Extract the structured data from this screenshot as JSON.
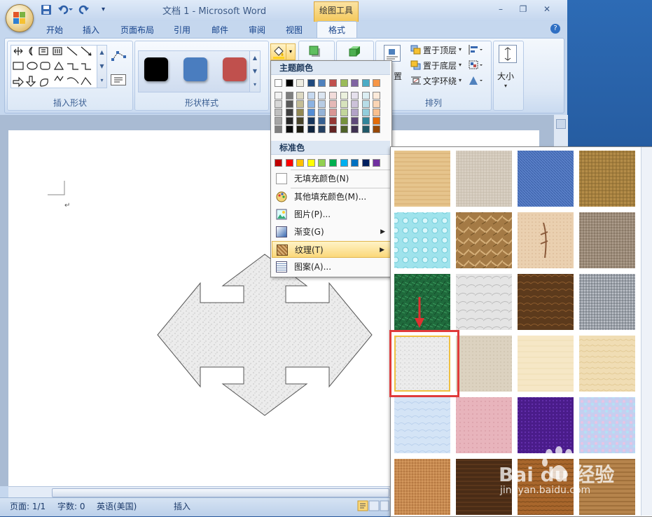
{
  "window": {
    "title": "文档 1 - Microsoft Word",
    "contextual_tab": "绘图工具",
    "min": "–",
    "max": "❐",
    "close": "✕"
  },
  "tabs": [
    "开始",
    "插入",
    "页面布局",
    "引用",
    "邮件",
    "审阅",
    "视图",
    "格式"
  ],
  "ribbon": {
    "groups": {
      "insert_shapes": "插入形状",
      "shape_styles": "形状样式",
      "arrange": "排列",
      "size": "大小"
    },
    "arrange": {
      "bring_front": "置于顶层",
      "send_back": "置于底层",
      "text_wrap": "文字环绕",
      "position_fragment": "置"
    },
    "style_colors": [
      "#000000",
      "#4a7dbf",
      "#c0504d"
    ]
  },
  "fill_menu": {
    "theme_colors_header": "主题颜色",
    "standard_colors_header": "标准色",
    "theme_top": [
      "#ffffff",
      "#000000",
      "#eeece1",
      "#1f497d",
      "#4f81bd",
      "#c0504d",
      "#9bbb59",
      "#8064a2",
      "#4bacc6",
      "#f79646"
    ],
    "theme_shades": [
      [
        "#f2f2f2",
        "#7f7f7f",
        "#ddd9c3",
        "#c6d9f0",
        "#dbe5f1",
        "#f2dcdb",
        "#ebf1dd",
        "#e5e0ec",
        "#dbeef3",
        "#fdeada"
      ],
      [
        "#d8d8d8",
        "#595959",
        "#c4bd97",
        "#8db3e2",
        "#b8cce4",
        "#e5b9b7",
        "#d7e3bc",
        "#ccc1d9",
        "#b7dde8",
        "#fbd5b5"
      ],
      [
        "#bfbfbf",
        "#3f3f3f",
        "#938953",
        "#548dd4",
        "#95b3d7",
        "#d99694",
        "#c3d69b",
        "#b2a2c7",
        "#92cddc",
        "#fac08f"
      ],
      [
        "#a5a5a5",
        "#262626",
        "#494429",
        "#17365d",
        "#366092",
        "#953734",
        "#76923c",
        "#5f497a",
        "#31859b",
        "#e36c09"
      ],
      [
        "#7f7f7f",
        "#0c0c0c",
        "#1d1b10",
        "#0f243e",
        "#244061",
        "#632423",
        "#4f6128",
        "#3f3151",
        "#205867",
        "#974806"
      ]
    ],
    "standard": [
      "#c00000",
      "#ff0000",
      "#ffc000",
      "#ffff00",
      "#92d050",
      "#00b050",
      "#00b0f0",
      "#0070c0",
      "#002060",
      "#7030a0"
    ],
    "items": {
      "no_fill": "无填充颜色(N)",
      "more_colors": "其他填充颜色(M)...",
      "picture": "图片(P)...",
      "gradient": "渐变(G)",
      "texture": "纹理(T)",
      "pattern": "图案(A)..."
    }
  },
  "status": {
    "page": "页面: 1/1",
    "words": "字数: 0",
    "language": "英语(美国)",
    "mode": "插入"
  },
  "size_label": "大小",
  "watermark": {
    "brand": "Bai du 经验",
    "url": "jingyan.baidu.com"
  }
}
